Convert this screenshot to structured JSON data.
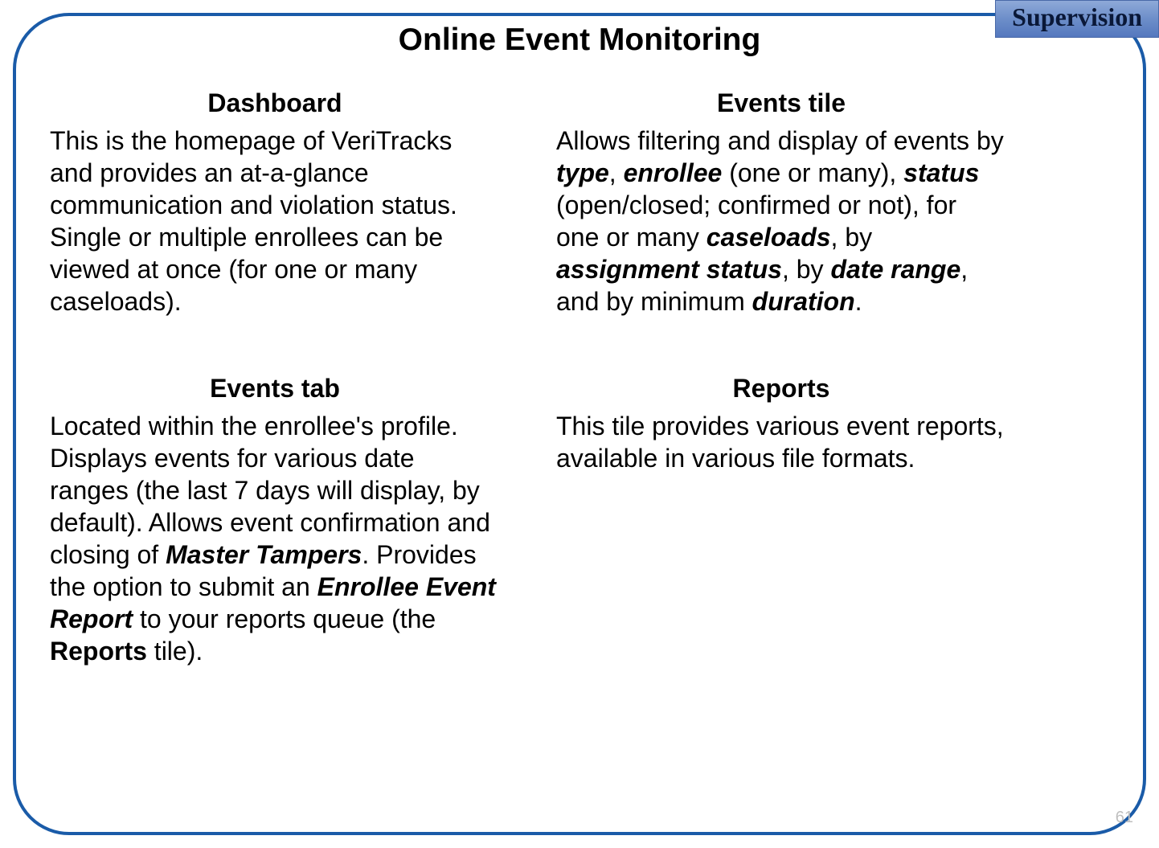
{
  "category": "Supervision",
  "title": "Online Event Monitoring",
  "sections": {
    "dashboard": {
      "heading": "Dashboard",
      "body": "This is the homepage of VeriTracks and  provides an at-a-glance communication and violation status. Single or multiple enrollees can be viewed at once (for one or many caseloads)."
    },
    "events_tile": {
      "heading": "Events tile",
      "body_parts": {
        "p1": "Allows filtering and display of events by ",
        "em1": "type",
        "p2": ", ",
        "em2": "enrollee",
        "p3": " (one or many), ",
        "em3": "status",
        "p4": " (open/closed; confirmed or not), for one or many ",
        "em4": "caseloads",
        "p5": ", by ",
        "em5": "assignment status",
        "p6": ", by ",
        "em6": "date range",
        "p7": ", and by minimum ",
        "em7": "duration",
        "p8": "."
      }
    },
    "events_tab": {
      "heading": "Events tab",
      "body_parts": {
        "p1": "Located within the enrollee's profile. Displays events for various date ranges (the last 7 days will display, by default). Allows event confirmation and closing of ",
        "em1": "Master Tampers",
        "p2": ". Provides the option to submit an ",
        "em2": "Enrollee Event Report",
        "p3": " to your reports queue (the ",
        "b1": "Reports",
        "p4": " tile)."
      }
    },
    "reports": {
      "heading": "Reports",
      "body": "This tile provides various event reports, available in various file formats."
    }
  },
  "page_number": "61"
}
